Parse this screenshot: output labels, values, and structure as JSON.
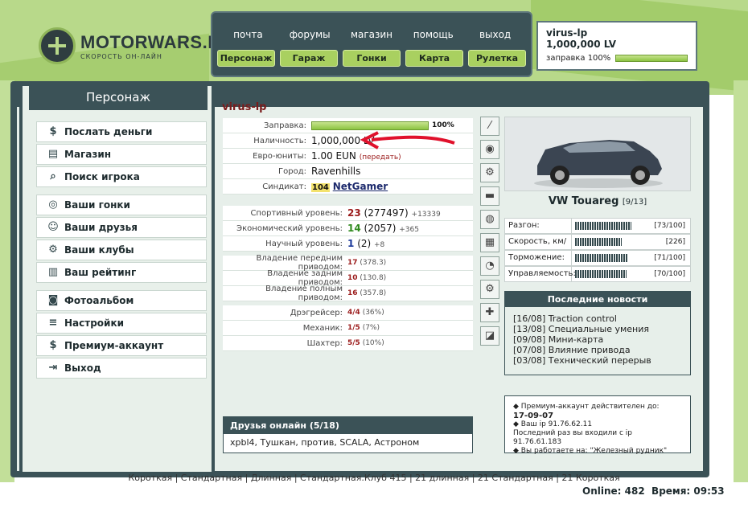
{
  "logo": {
    "name": "MOTORWARS.RU",
    "tagline": "СКОРОСТЬ ОН-ЛАЙН"
  },
  "topnav": {
    "links": [
      "почта",
      "форумы",
      "магазин",
      "помощь",
      "выход"
    ],
    "buttons": [
      "Персонаж",
      "Гараж",
      "Гонки",
      "Карта",
      "Рулетка"
    ]
  },
  "userbox": {
    "name": "virus-lp",
    "money": "1,000,000 LV",
    "refuel": "заправка 100%",
    "refuel_level": 100
  },
  "sidebar": {
    "title": "Персонаж",
    "items": [
      {
        "label": "Послать деньги",
        "icon": "money-icon"
      },
      {
        "label": "Магазин",
        "icon": "shop-icon"
      },
      {
        "label": "Поиск игрока",
        "icon": "search-icon"
      },
      {
        "label": "Ваши гонки",
        "icon": "steering-wheel-icon"
      },
      {
        "label": "Ваши друзья",
        "icon": "friends-icon"
      },
      {
        "label": "Ваши клубы",
        "icon": "clubs-icon"
      },
      {
        "label": "Ваш рейтинг",
        "icon": "rating-icon"
      },
      {
        "label": "Фотоальбом",
        "icon": "camera-icon"
      },
      {
        "label": "Настройки",
        "icon": "settings-icon"
      },
      {
        "label": "Премиум-аккаунт",
        "icon": "premium-icon"
      },
      {
        "label": "Выход",
        "icon": "exit-icon"
      }
    ]
  },
  "profile": {
    "name": "virus-lp",
    "refuel": {
      "label": "Заправка:",
      "value": "100%",
      "level": 100
    },
    "cash": {
      "label": "Наличность:",
      "value": "1,000,000 LV"
    },
    "euro": {
      "label": "Евро-юниты:",
      "value": "1.00 EUN",
      "action": "(передать)"
    },
    "city": {
      "label": "Город:",
      "value": "Ravenhills"
    },
    "syndicate": {
      "label": "Синдикат:",
      "id": "104",
      "value": "NetGamer"
    },
    "sport": {
      "label": "Спортивный уровень:",
      "level": "23",
      "points": "(277497)",
      "delta": "+13339"
    },
    "econ": {
      "label": "Экономический уровень:",
      "level": "14",
      "points": "(2057)",
      "delta": "+365"
    },
    "science": {
      "label": "Научный уровень:",
      "level": "1",
      "points": "(2)",
      "delta": "+8"
    },
    "fwd": {
      "label": "Владение передним приводом:",
      "level": "17",
      "points": "(378.3)"
    },
    "rwd": {
      "label": "Владение задним приводом:",
      "level": "10",
      "points": "(130.8)"
    },
    "awd": {
      "label": "Владение полным приводом:",
      "level": "16",
      "points": "(357.8)"
    },
    "drag": {
      "label": "Дрэгрейсер:",
      "value": "4/4",
      "pct": "(36%)"
    },
    "mech": {
      "label": "Механик:",
      "value": "1/5",
      "pct": "(7%)"
    },
    "miner": {
      "label": "Шахтер:",
      "value": "5/5",
      "pct": "(10%)"
    }
  },
  "friends": {
    "title": "Друзья онлайн (5/18)",
    "list": "xpbl4, Тушкан, против, SCALA, Астроном"
  },
  "car": {
    "name": "VW Touareg",
    "slot": "[9/13]",
    "specs": [
      {
        "label": "Разгон:",
        "value": "[73/100]",
        "level": 73
      },
      {
        "label": "Скорость, км/ч:",
        "value": "[226]",
        "level": 60
      },
      {
        "label": "Торможение:",
        "value": "[71/100]",
        "level": 71
      },
      {
        "label": "Управляемость:",
        "value": "[70/100]",
        "level": 70
      }
    ]
  },
  "news": {
    "title": "Последние новости",
    "items": [
      {
        "date": "[16/08]",
        "text": "Traction control"
      },
      {
        "date": "[13/08]",
        "text": "Специальные умения"
      },
      {
        "date": "[09/08]",
        "text": "Мини-карта"
      },
      {
        "date": "[07/08]",
        "text": "Влияние привода"
      },
      {
        "date": "[03/08]",
        "text": "Технический перерыв"
      }
    ]
  },
  "info": {
    "premium": "Премиум-аккаунт действителен до:",
    "premium_date": "17-09-07",
    "ip": "Ваш ip 91.76.62.11",
    "last_ip": "Последний раз вы входили с ip 91.76.61.183",
    "location": "Вы работаете на: \"Железный рудник\""
  },
  "footer": {
    "links": [
      "Короткая",
      "Стандартная",
      "Длинная",
      "Стандартная.Клуб 415",
      "21 длинная",
      "21 Стандартная",
      "21 Короткая"
    ],
    "online": "Online: 482",
    "time": "Время: 09:53"
  }
}
